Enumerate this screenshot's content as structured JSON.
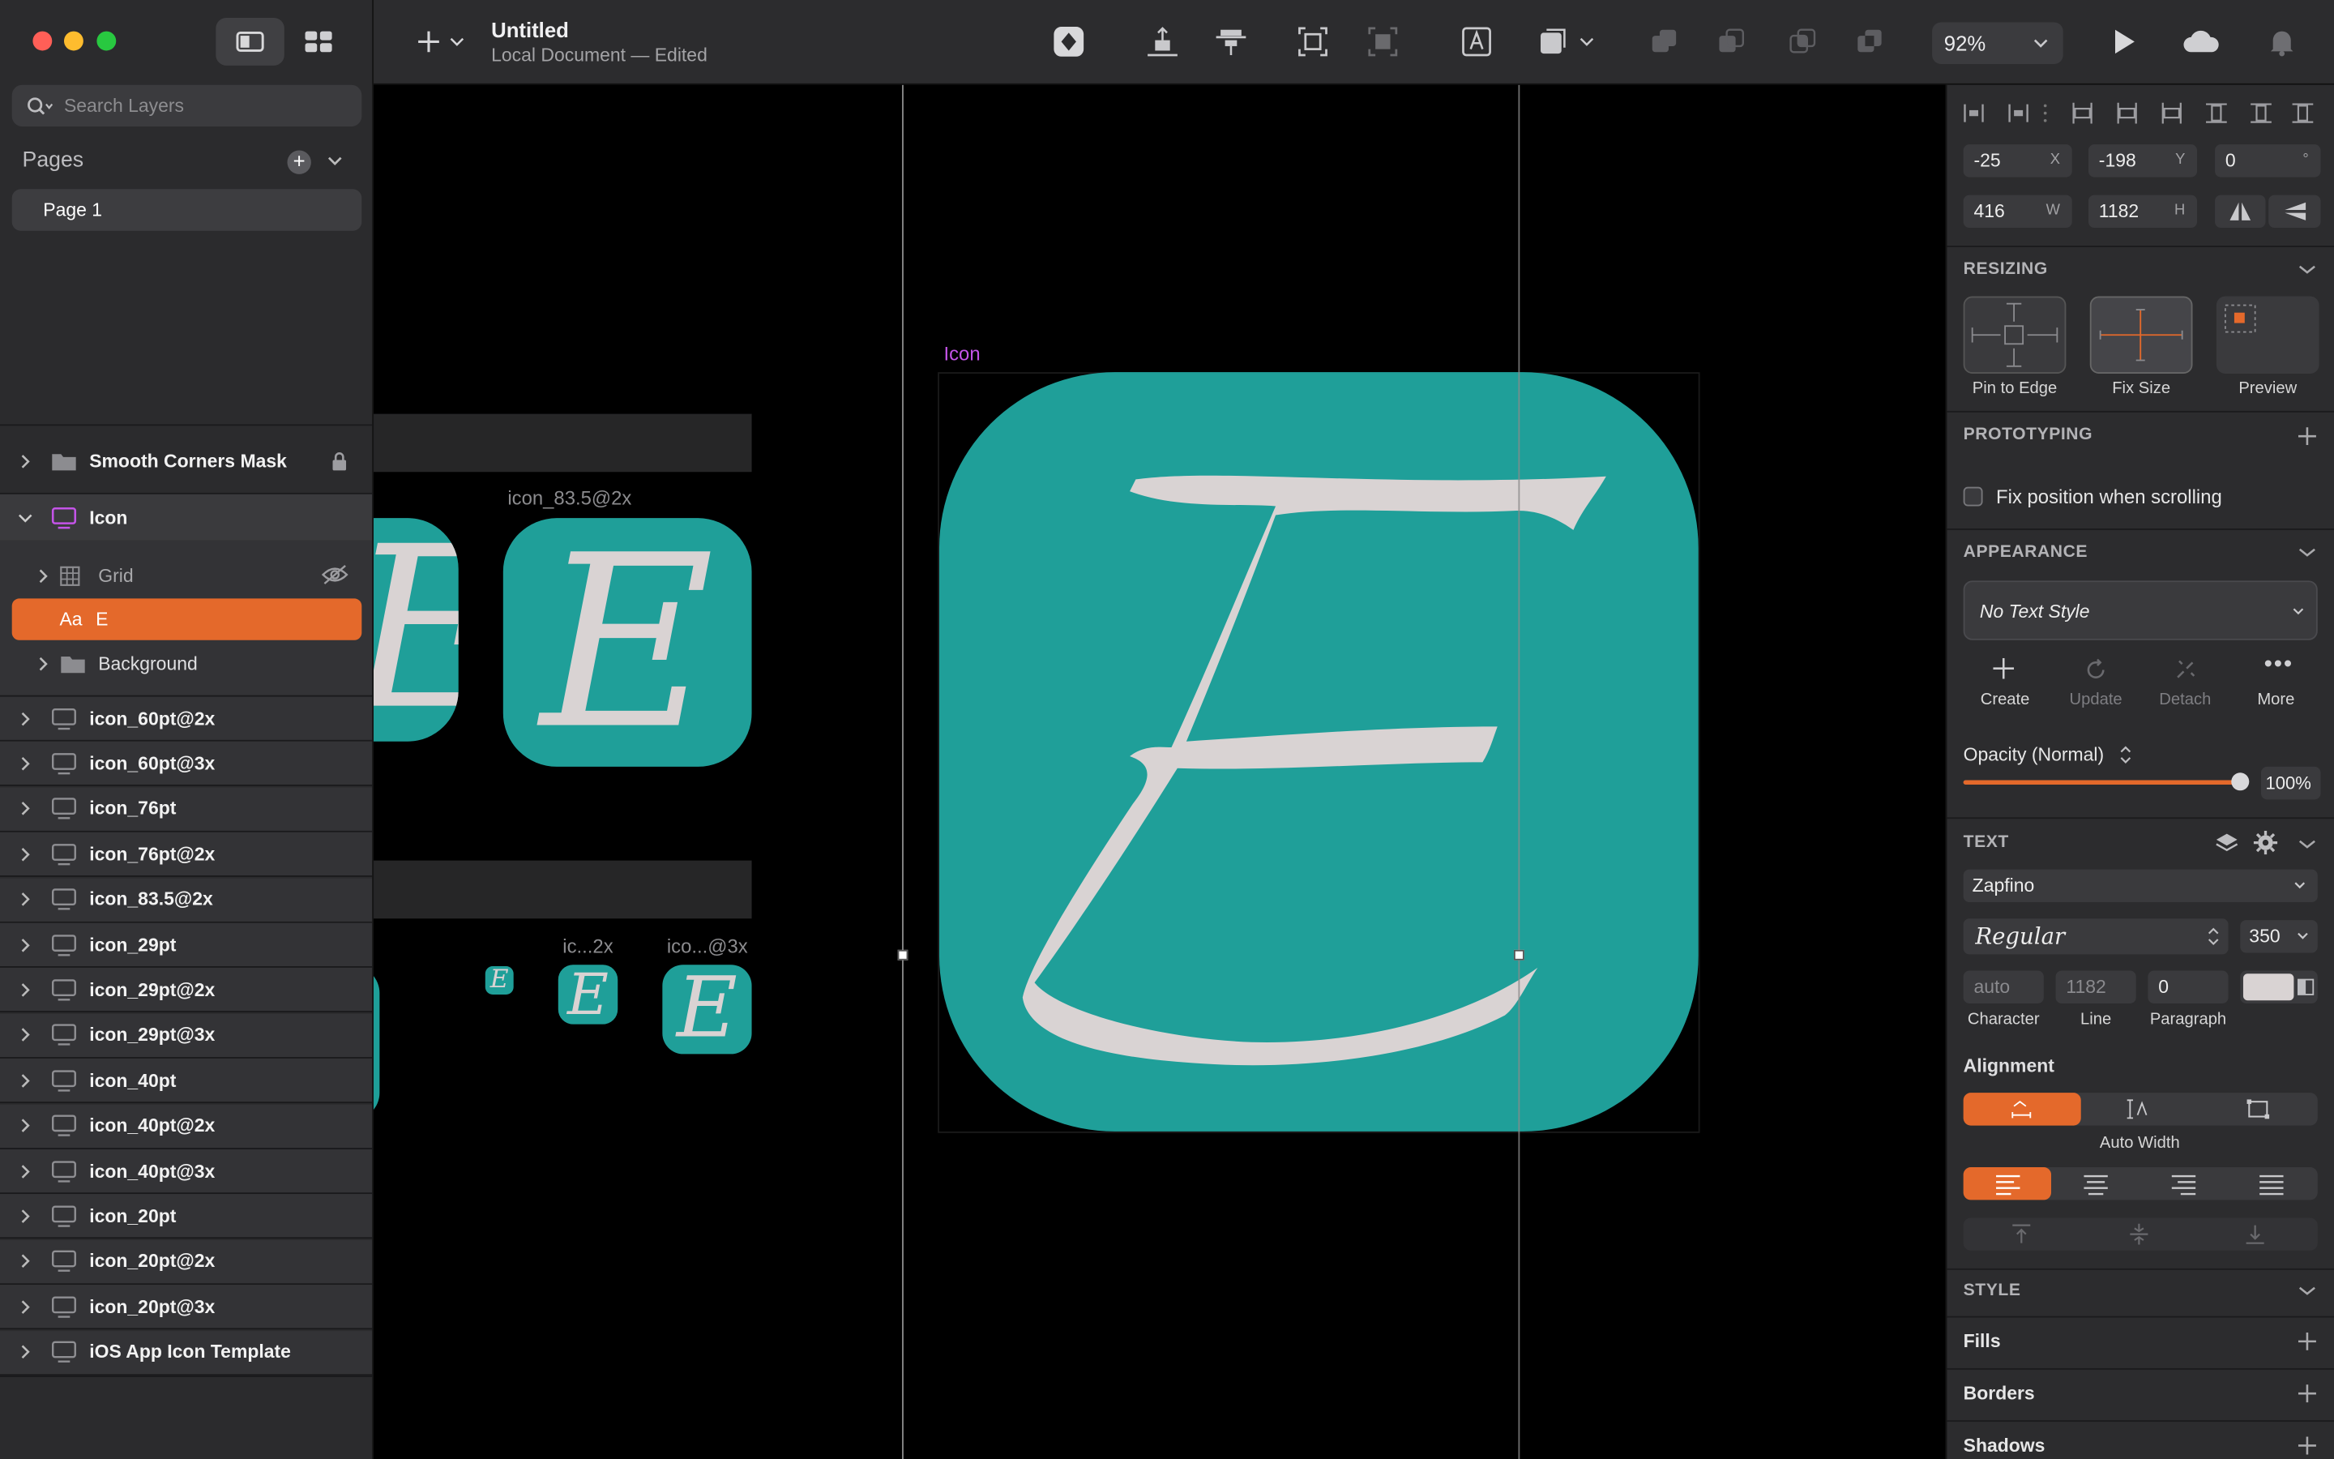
{
  "window": {
    "title": "Untitled",
    "subtitle": "Local Document — Edited",
    "zoom": "92%"
  },
  "sidebar": {
    "search_placeholder": "Search Layers",
    "pages_header": "Pages",
    "pages": [
      "Page 1"
    ],
    "layers": {
      "smooth": "Smooth Corners Mask",
      "icon": "Icon",
      "grid": "Grid",
      "e_prefix": "Aa",
      "e": "E",
      "background": "Background",
      "list": [
        "icon_60pt@2x",
        "icon_60pt@3x",
        "icon_76pt",
        "icon_76pt@2x",
        "icon_83.5@2x",
        "icon_29pt",
        "icon_29pt@2x",
        "icon_29pt@3x",
        "icon_40pt",
        "icon_40pt@2x",
        "icon_40pt@3x",
        "icon_20pt",
        "icon_20pt@2x",
        "icon_20pt@3x",
        "iOS App Icon Template"
      ]
    }
  },
  "canvas": {
    "artboard_label": "Icon",
    "label_83": "icon_83.5@2x",
    "label_small_2x": "ic...2x",
    "label_small_3x": "ico...@3x",
    "glyph": "E"
  },
  "inspector": {
    "x": "-25",
    "x_suffix": "X",
    "y": "-198",
    "y_suffix": "Y",
    "rotation": "0",
    "rotation_suffix": "°",
    "w": "416",
    "w_suffix": "W",
    "h": "1182",
    "h_suffix": "H",
    "resizing": {
      "title": "RESIZING",
      "pin": "Pin to Edge",
      "fix": "Fix Size",
      "preview": "Preview"
    },
    "prototyping": {
      "title": "PROTOTYPING",
      "fix_position": "Fix position when scrolling"
    },
    "appearance": {
      "title": "APPEARANCE",
      "text_style": "No Text Style",
      "create": "Create",
      "update": "Update",
      "detach": "Detach",
      "more": "More"
    },
    "opacity": {
      "label": "Opacity (Normal)",
      "value": "100%",
      "fraction": 1.0
    },
    "text": {
      "title": "TEXT",
      "font": "Zapfino",
      "weight": "Regular",
      "size": "350",
      "character": "auto",
      "line": "1182",
      "paragraph": "0",
      "character_label": "Character",
      "line_label": "Line",
      "paragraph_label": "Paragraph",
      "alignment": "Alignment",
      "auto_width": "Auto Width"
    },
    "style": {
      "title": "STYLE",
      "fills": "Fills",
      "borders": "Borders",
      "shadows": "Shadows"
    }
  },
  "colors": {
    "accent": "#e4692b",
    "teal": "#1f9f99",
    "letter": "#d9d3d3",
    "artboard_label": "#c454e8"
  }
}
